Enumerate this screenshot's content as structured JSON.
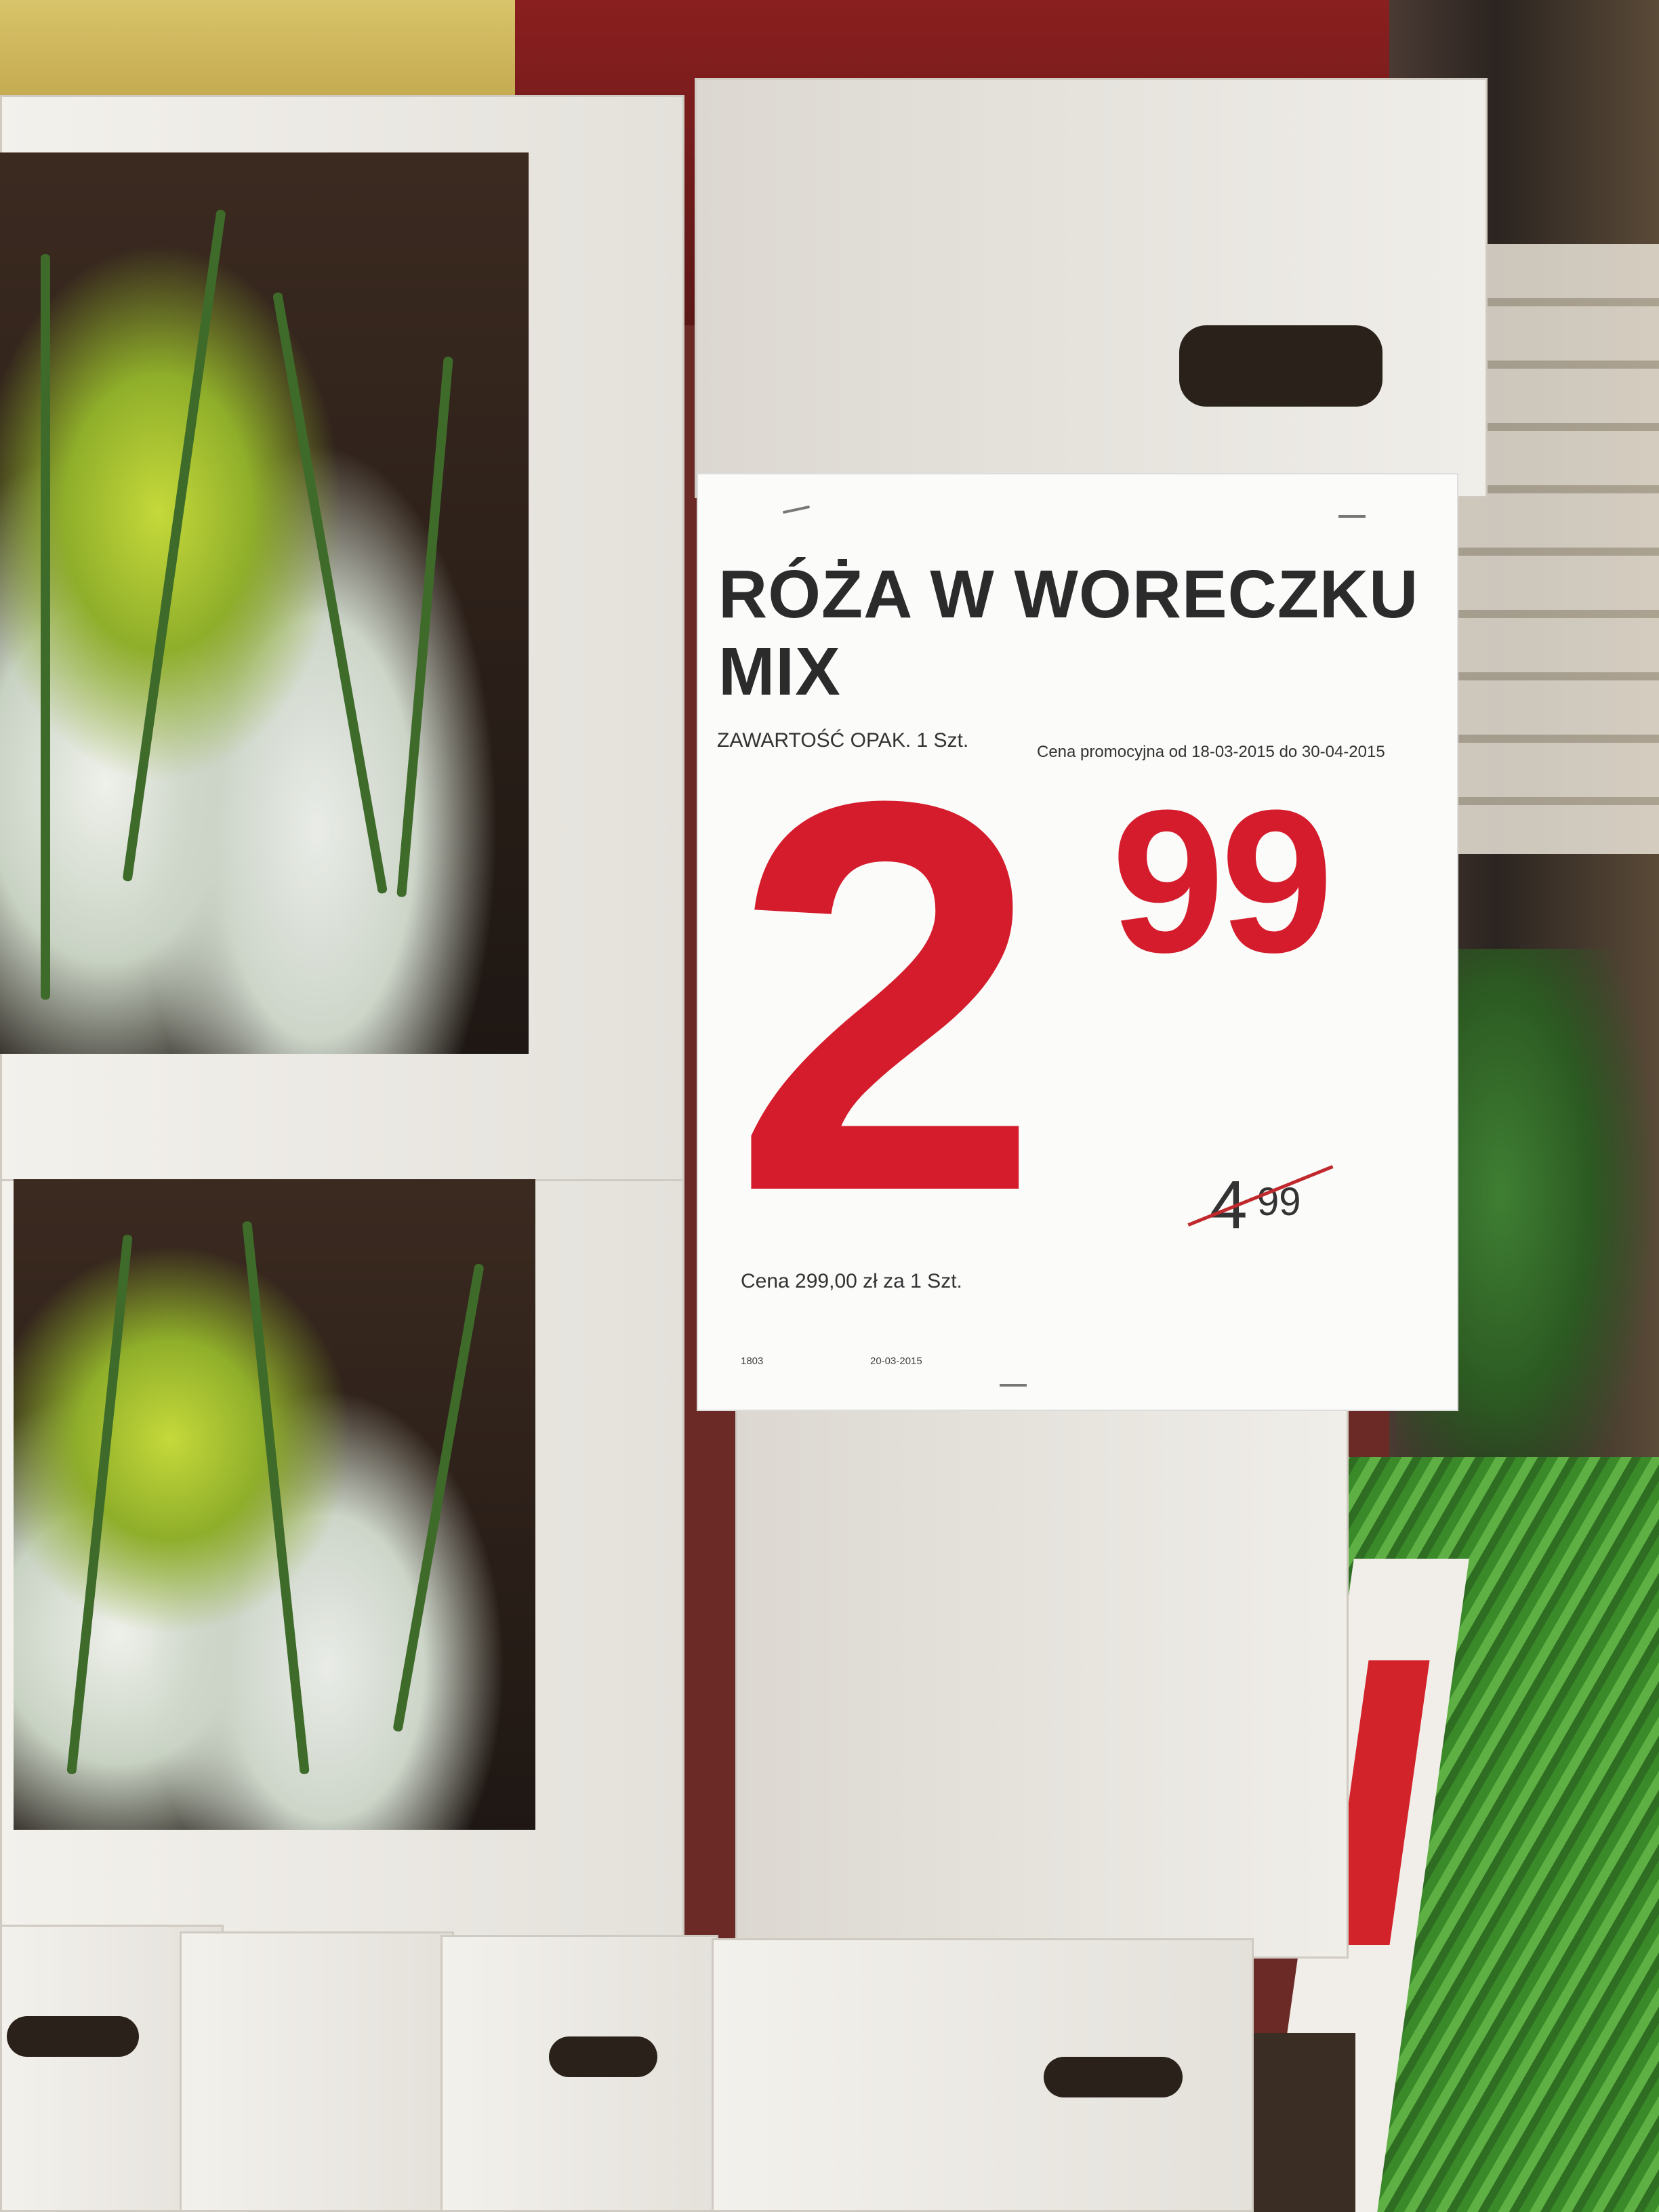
{
  "sign": {
    "title_line1": "RÓŻA W WORECZKU",
    "title_line2": "MIX",
    "pack_info": "ZAWARTOŚĆ OPAK. 1 Szt.",
    "promo_period": "Cena promocyjna od 18-03-2015 do 30-04-2015",
    "price_integer": "2",
    "price_decimal": "99",
    "old_price_integer": "4",
    "old_price_decimal": "99",
    "unit_price": "Cena 299,00 zł za 1 Szt.",
    "product_code": "1803",
    "print_date": "20-03-2015",
    "price_color": "#d41c2c"
  }
}
